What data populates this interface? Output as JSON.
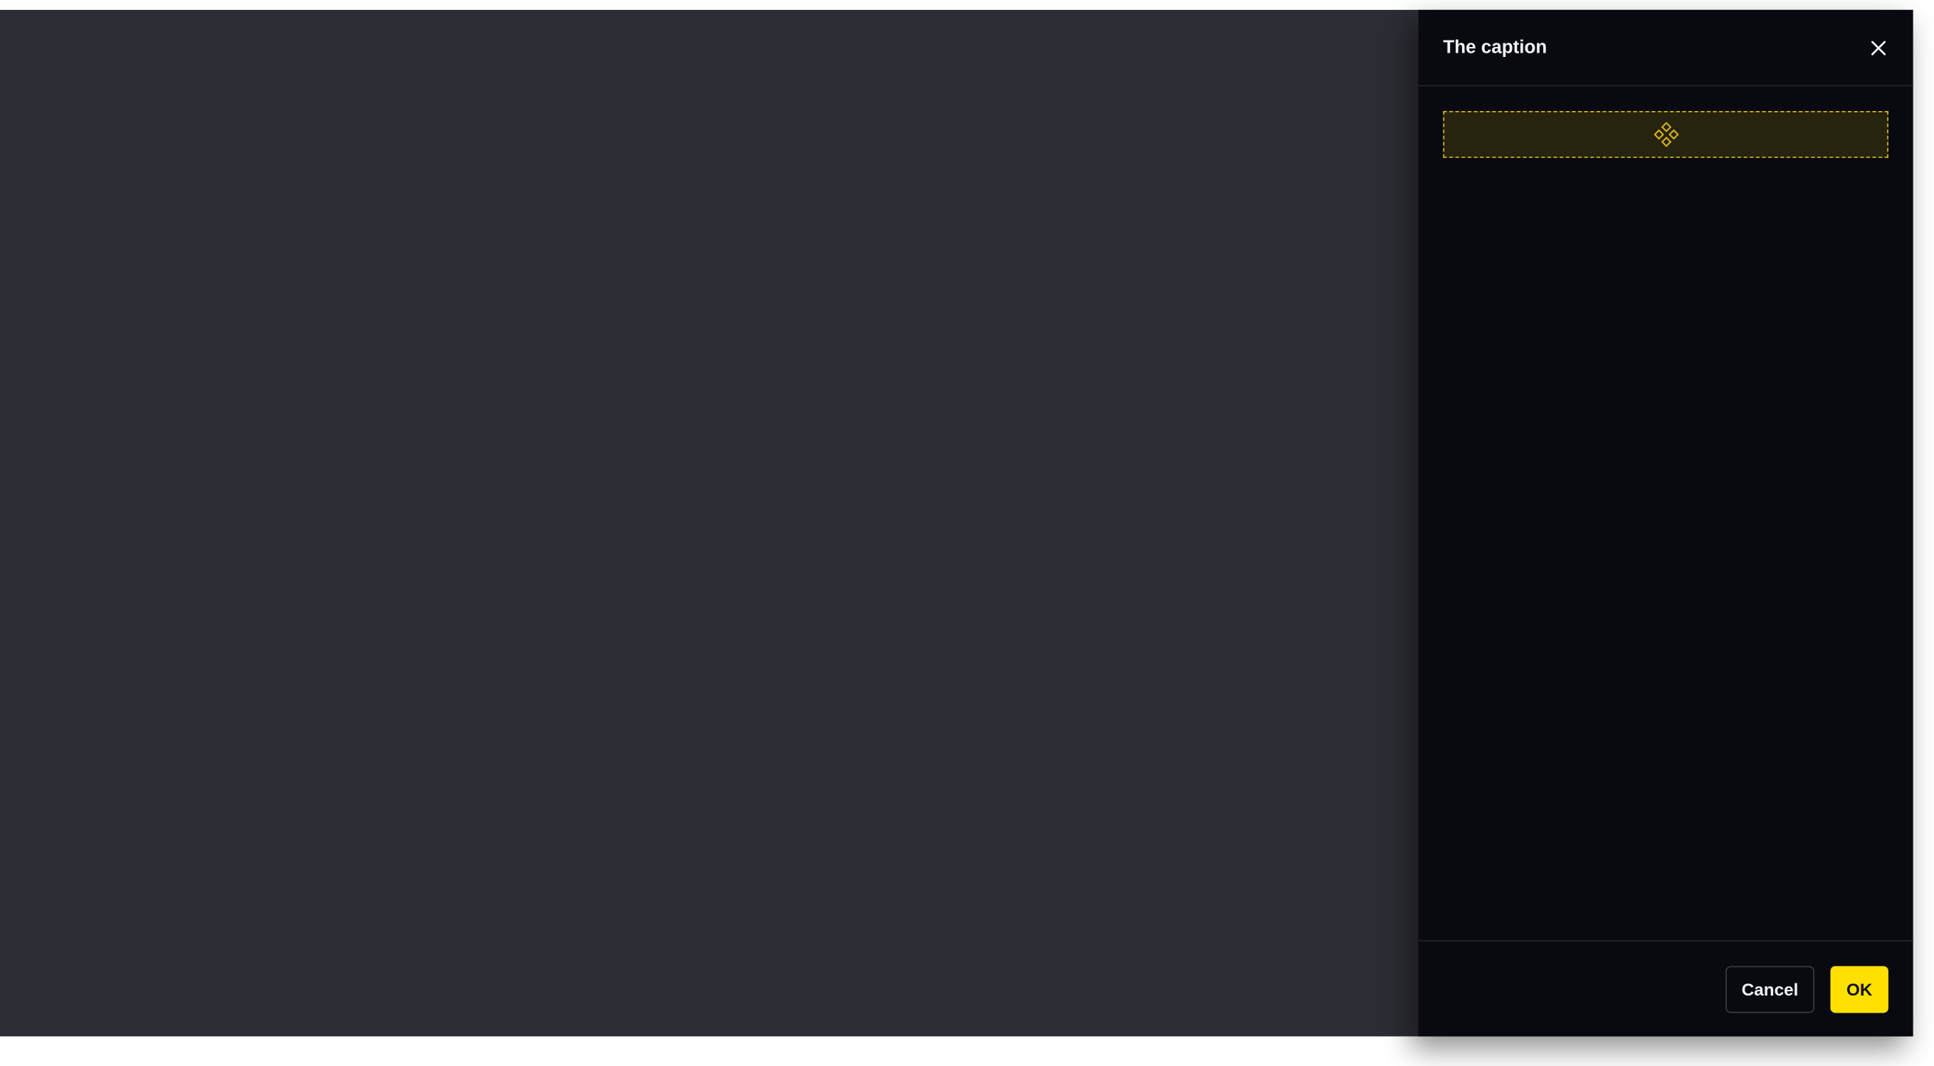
{
  "drawer": {
    "title": "The caption",
    "close_icon": "close-icon",
    "drop_zone_icon": "diamond-components-icon"
  },
  "footer": {
    "cancel_label": "Cancel",
    "ok_label": "OK"
  },
  "colors": {
    "page_background": "#2c2c34",
    "drawer_background": "#090910",
    "accent": "#ffe000",
    "drop_zone_border": "#d7b51f",
    "drop_zone_fill": "#26230f"
  }
}
